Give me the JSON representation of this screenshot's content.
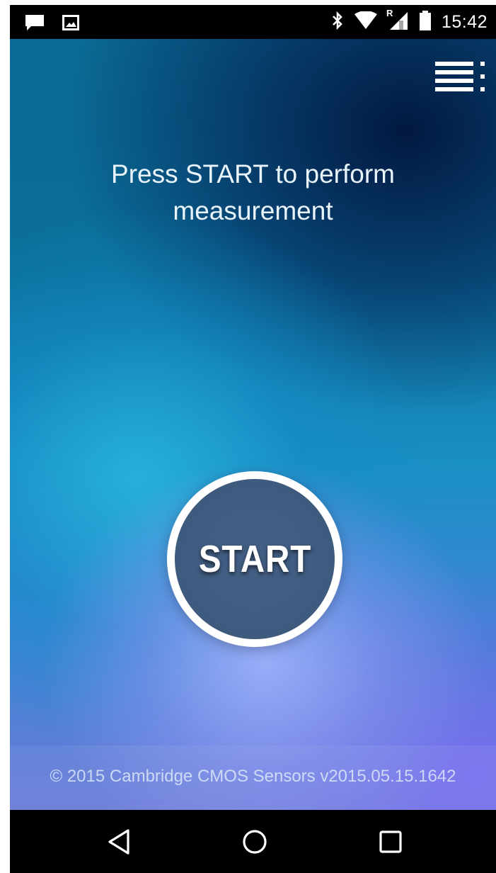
{
  "status_bar": {
    "time": "15:42",
    "icons": [
      "message-notification-icon",
      "image-notification-icon",
      "bluetooth-icon",
      "wifi-icon",
      "roaming-signal-icon",
      "battery-icon"
    ],
    "roaming_mark": "R"
  },
  "app": {
    "instruction": "Press START to perform\nmeasurement",
    "start_label": "START",
    "copyright": "© 2015 Cambridge CMOS Sensors v2015.05.15.1642",
    "menu_icon": "menu-icon"
  },
  "nav_bar": {
    "icons": [
      "back-icon",
      "home-icon",
      "recents-icon"
    ]
  },
  "colors": {
    "start_fill": "#3f5c80",
    "ring": "#ffffff",
    "text": "#e9f4fb",
    "bar_background": "#000000"
  }
}
